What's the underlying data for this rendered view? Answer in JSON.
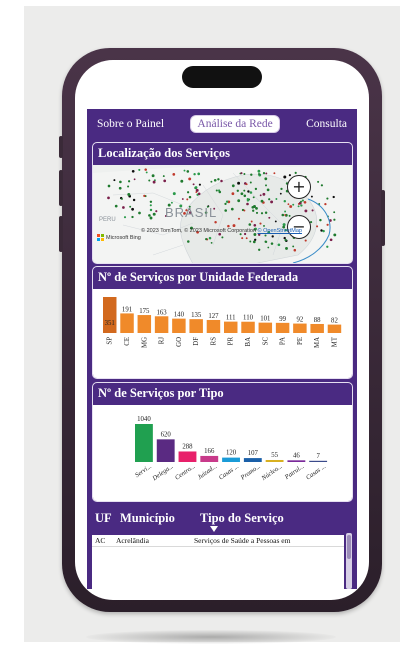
{
  "colors": {
    "primary": "#4a2a82",
    "bar_uf": "#f08a2a",
    "bar_uf_highlight": "#d2691e",
    "phone_frame": "#3a2a38"
  },
  "nav": {
    "tabs": [
      {
        "label": "Sobre o Painel",
        "active": false
      },
      {
        "label": "Análise da Rede",
        "active": true
      },
      {
        "label": "Consulta",
        "active": false
      }
    ]
  },
  "map_panel": {
    "title": "Localização dos Serviços",
    "country_label": "BRASIL",
    "region_label": "PERU",
    "zoom_in": "+",
    "zoom_out": "−",
    "attribution": "© 2023 TomTom, © 2023 Microsoft Corporation",
    "attribution_link": "© OpenStreetMap",
    "provider": "Microsoft Bing"
  },
  "uf_panel": {
    "title": "Nº de Serviços por Unidade Federada"
  },
  "type_panel": {
    "title": "Nº de Serviços por Tipo"
  },
  "chart_data": [
    {
      "type": "bar",
      "title": "Nº de Serviços por Unidade Federada",
      "categories": [
        "SP",
        "CE",
        "MG",
        "RJ",
        "GO",
        "DF",
        "RS",
        "PR",
        "BA",
        "SC",
        "PA",
        "PE",
        "MA",
        "MT"
      ],
      "values": [
        351,
        191,
        175,
        163,
        140,
        135,
        127,
        111,
        110,
        101,
        99,
        92,
        88,
        82
      ],
      "color": "#f08a2a"
    },
    {
      "type": "bar",
      "title": "Nº de Serviços por Tipo",
      "categories": [
        "Servi...",
        "Delega...",
        "Centro...",
        "Juizad...",
        "Casas ...",
        "Promo...",
        "Núcleo...",
        "Patrul...",
        "Casas ..."
      ],
      "values": [
        1040,
        620,
        288,
        166,
        120,
        107,
        55,
        46,
        7
      ],
      "colors": [
        "#20a050",
        "#5a2a82",
        "#e8206a",
        "#c83a8a",
        "#1a9bd7",
        "#1a5fa8",
        "#d8b020",
        "#7a2a9a",
        "#3a4a8a"
      ]
    }
  ],
  "table": {
    "headers": [
      "UF",
      "Município",
      "Tipo do Serviço"
    ],
    "rows": [
      {
        "uf": "AC",
        "municipio": "Acrelândia",
        "tipo": "Serviços de Saúde a Pessoas em"
      }
    ]
  }
}
